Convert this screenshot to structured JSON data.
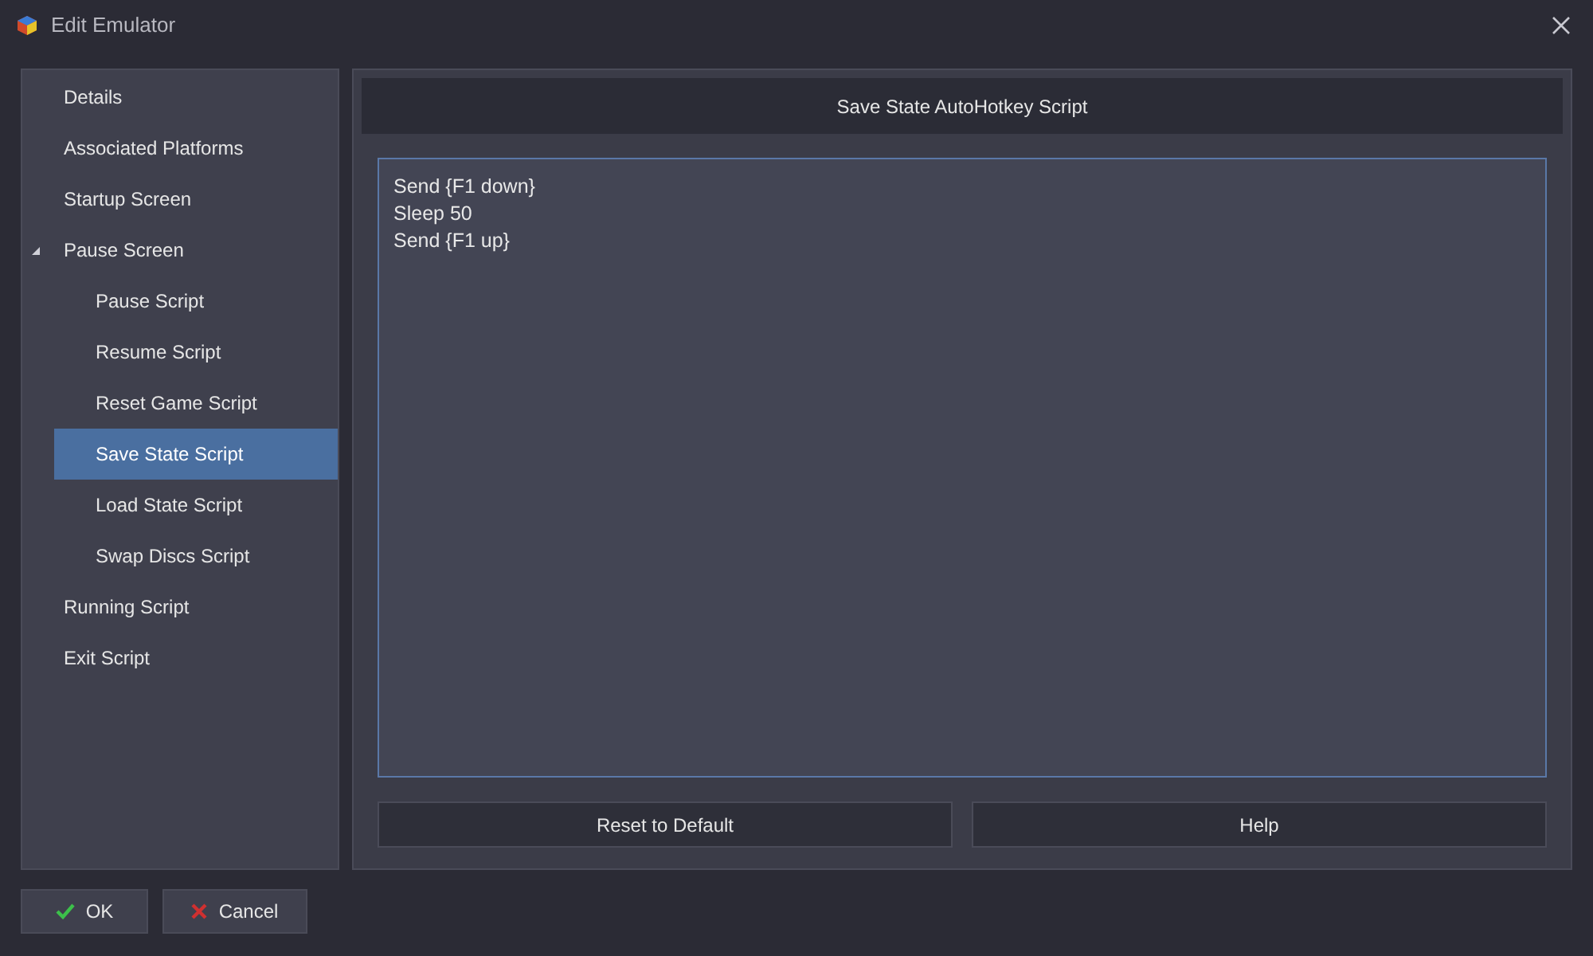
{
  "window": {
    "title": "Edit Emulator"
  },
  "sidebar": {
    "items": [
      {
        "label": "Details",
        "selected": false
      },
      {
        "label": "Associated Platforms",
        "selected": false
      },
      {
        "label": "Startup Screen",
        "selected": false
      },
      {
        "label": "Pause Screen",
        "selected": false,
        "expanded": true,
        "children": [
          {
            "label": "Pause Script",
            "selected": false
          },
          {
            "label": "Resume Script",
            "selected": false
          },
          {
            "label": "Reset Game Script",
            "selected": false
          },
          {
            "label": "Save State Script",
            "selected": true
          },
          {
            "label": "Load State Script",
            "selected": false
          },
          {
            "label": "Swap Discs Script",
            "selected": false
          }
        ]
      },
      {
        "label": "Running Script",
        "selected": false
      },
      {
        "label": "Exit Script",
        "selected": false
      }
    ]
  },
  "panel": {
    "title": "Save State AutoHotkey Script",
    "script": "Send {F1 down}\nSleep 50\nSend {F1 up}",
    "buttons": [
      "Reset to Default",
      "Help"
    ]
  },
  "footer": {
    "buttons": [
      {
        "label": "OK",
        "kind": "ok"
      },
      {
        "label": "Cancel",
        "kind": "cancel"
      }
    ]
  }
}
